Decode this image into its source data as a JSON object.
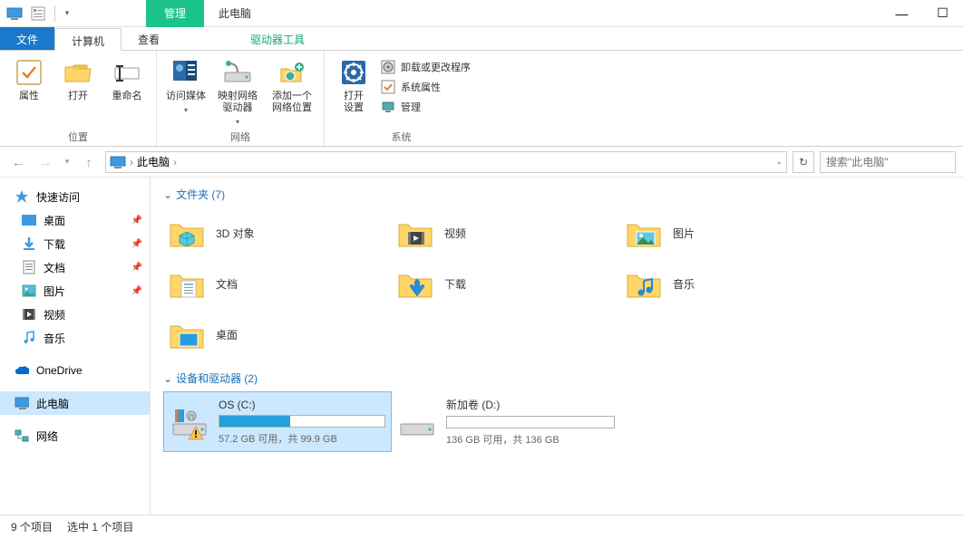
{
  "title": "此电脑",
  "manage_tab": "管理",
  "menu": {
    "file": "文件",
    "computer": "计算机",
    "view": "查看",
    "drive_tools": "驱动器工具"
  },
  "ribbon": {
    "location": {
      "label": "位置",
      "properties": "属性",
      "open": "打开",
      "rename": "重命名"
    },
    "network": {
      "label": "网络",
      "media": "访问媒体",
      "map_drive": "映射网络\n驱动器",
      "add_loc": "添加一个\n网络位置"
    },
    "system": {
      "label": "系统",
      "open_settings": "打开\n设置",
      "uninstall": "卸载或更改程序",
      "sys_props": "系统属性",
      "manage": "管理"
    }
  },
  "breadcrumb": {
    "root": "此电脑"
  },
  "search_placeholder": "搜索\"此电脑\"",
  "sidebar": {
    "quick_access": "快速访问",
    "desktop": "桌面",
    "downloads": "下载",
    "documents": "文档",
    "pictures": "图片",
    "videos": "视频",
    "music": "音乐",
    "onedrive": "OneDrive",
    "this_pc": "此电脑",
    "network": "网络"
  },
  "sections": {
    "folders": {
      "title": "文件夹 (7)"
    },
    "drives": {
      "title": "设备和驱动器 (2)"
    }
  },
  "folders": [
    {
      "name": "3D 对象"
    },
    {
      "name": "视频"
    },
    {
      "name": "图片"
    },
    {
      "name": "文档"
    },
    {
      "name": "下载"
    },
    {
      "name": "音乐"
    },
    {
      "name": "桌面"
    }
  ],
  "drives": [
    {
      "name": "OS (C:)",
      "free": "57.2 GB 可用，共 99.9 GB",
      "fill_pct": 43,
      "warning": true
    },
    {
      "name": "新加卷 (D:)",
      "free": "136 GB 可用，共 136 GB",
      "fill_pct": 0,
      "warning": false
    }
  ],
  "status": {
    "items": "9 个项目",
    "selected": "选中 1 个项目"
  }
}
